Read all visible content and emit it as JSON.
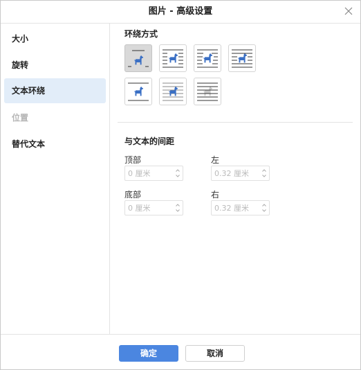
{
  "dialog": {
    "title": "图片 - 高级设置"
  },
  "sidebar": {
    "items": [
      {
        "label": "大小",
        "state": "normal"
      },
      {
        "label": "旋转",
        "state": "normal"
      },
      {
        "label": "文本环绕",
        "state": "active"
      },
      {
        "label": "位置",
        "state": "disabled"
      },
      {
        "label": "替代文本",
        "state": "normal"
      }
    ]
  },
  "wrapping": {
    "title": "环绕方式",
    "icons": [
      "inline-wrap-icon",
      "square-wrap-icon",
      "tight-wrap-icon",
      "through-wrap-icon",
      "top-bottom-wrap-icon",
      "in-front-wrap-icon",
      "behind-wrap-icon"
    ],
    "selected_index": 0
  },
  "distance": {
    "title": "与文本的间距",
    "top": {
      "label": "顶部",
      "value": "0 厘米"
    },
    "left": {
      "label": "左",
      "value": "0.32 厘米"
    },
    "bottom": {
      "label": "底部",
      "value": "0 厘米"
    },
    "right": {
      "label": "右",
      "value": "0.32 厘米"
    }
  },
  "footer": {
    "ok_label": "确定",
    "cancel_label": "取消"
  },
  "colors": {
    "accent": "#4b86e0",
    "icon_blue": "#3a6fc4",
    "active_nav": "#e2edf9"
  }
}
